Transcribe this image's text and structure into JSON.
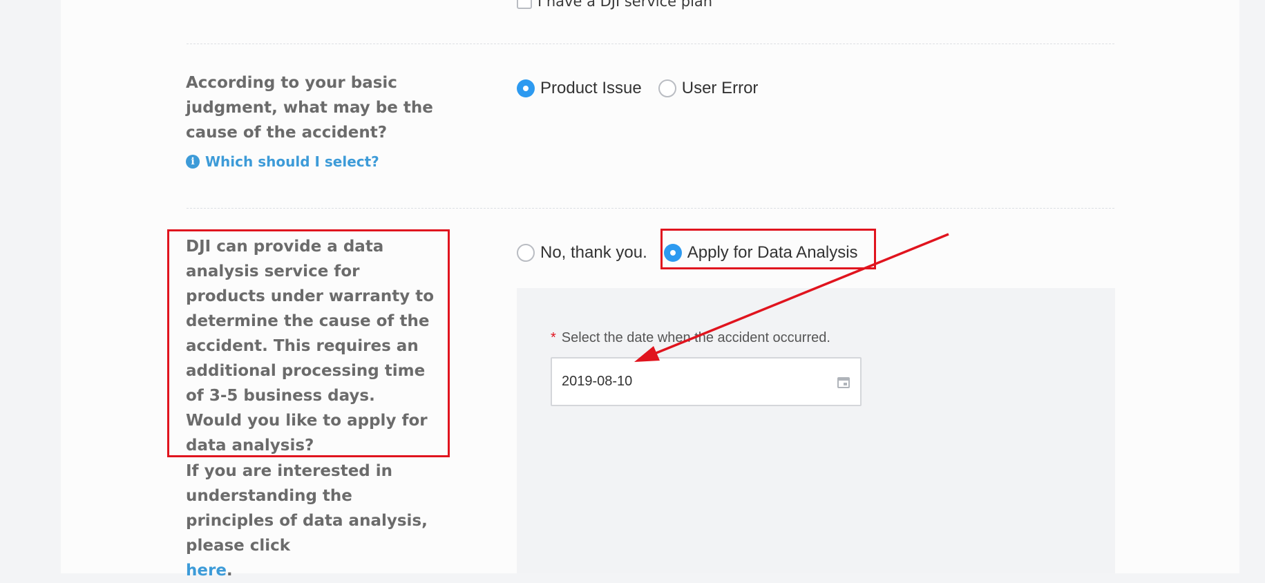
{
  "service_plan": {
    "label": "I have a DJI service plan"
  },
  "cause": {
    "question": "According to your basic judgment, what may be the cause of the accident?",
    "help_link": "Which should I select?",
    "options": [
      {
        "label": "Product Issue",
        "selected": true
      },
      {
        "label": "User Error",
        "selected": false
      }
    ]
  },
  "data_analysis": {
    "question": "DJI can provide a data analysis service for products under warranty to determine the cause of the accident. This requires an additional processing time of 3-5 business days. Would you like to apply for data analysis?",
    "options": [
      {
        "label": "No, thank you.",
        "selected": false
      },
      {
        "label": "Apply for Data Analysis",
        "selected": true
      }
    ],
    "date_label": "Select the date when the accident occurred.",
    "required_mark": "*",
    "date_value": "2019-08-10",
    "principles_text": "If you are interested in understanding the principles of data analysis, please click",
    "principles_link": "here",
    "principles_end": "."
  },
  "colors": {
    "accent": "#2d9af0",
    "link": "#3d9bd8",
    "annotation_red": "#e0141e"
  }
}
